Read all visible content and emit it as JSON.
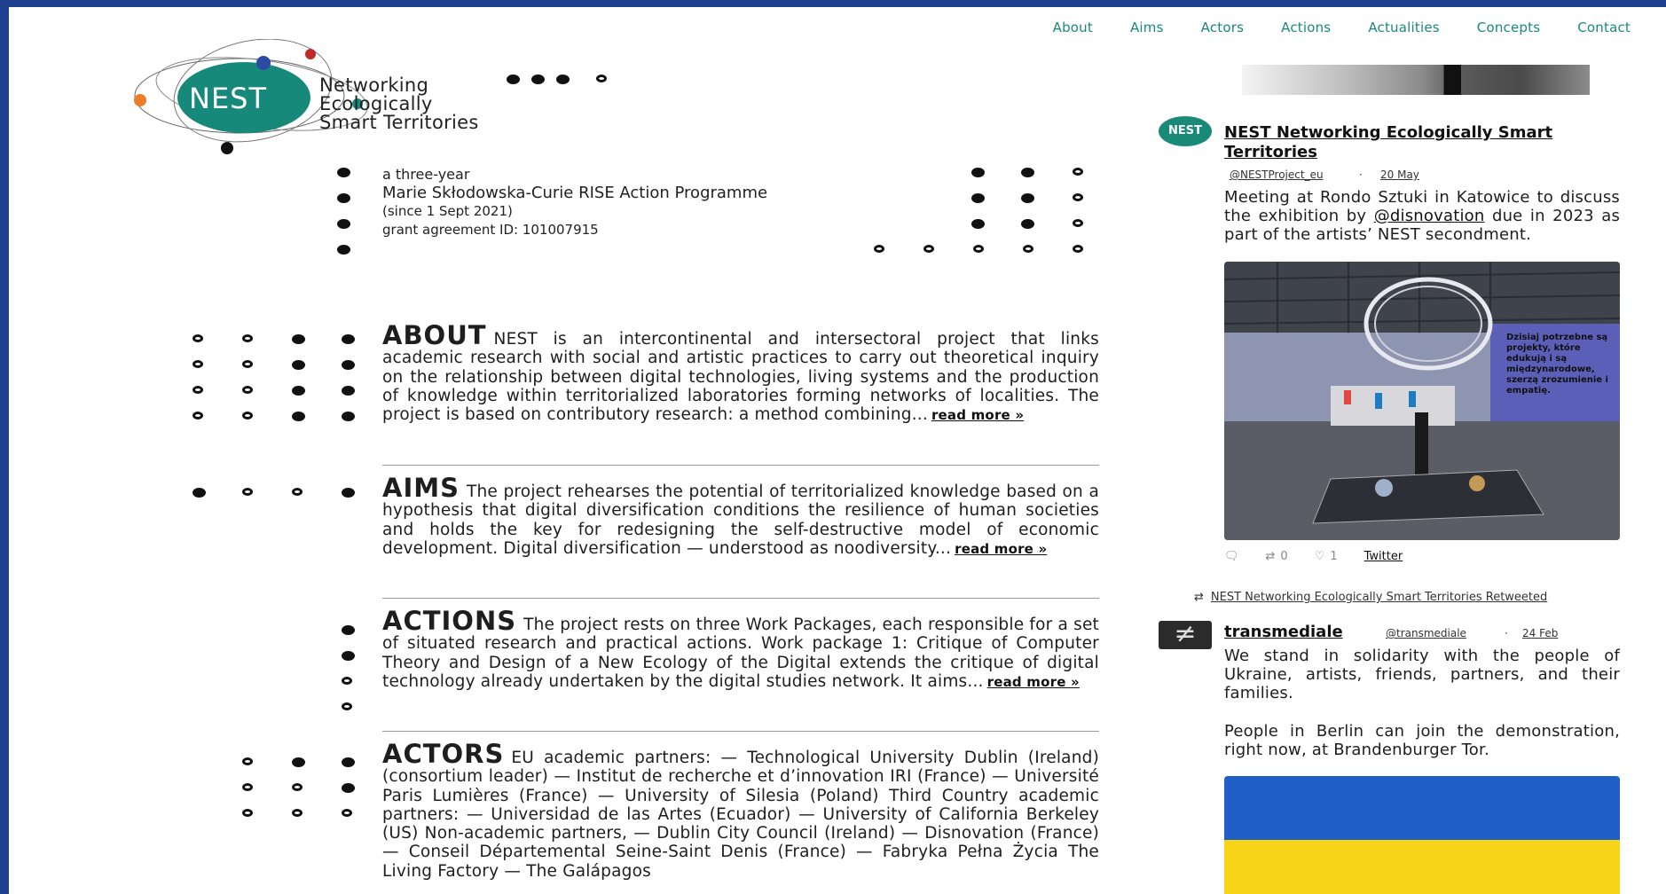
{
  "nav": [
    "About",
    "Aims",
    "Actors",
    "Actions",
    "Actualities",
    "Concepts",
    "Contact"
  ],
  "logo": {
    "mark": "NEST",
    "line1": "Networking",
    "line2": "Ecologically",
    "line3": "Smart Territories"
  },
  "intro": {
    "line1": "a three-year",
    "line2": "Marie Skłodowska-Curie RISE Action Programme",
    "line3": "(since 1 Sept 2021)",
    "line4": "grant agreement ID: 101007915"
  },
  "sections": {
    "about": {
      "head": "ABOUT",
      "text": "NEST is an intercontinental and intersectoral project that links academic research with social and artistic practices to carry out theoretical inquiry on the relationship between digital technologies, living systems and the production of knowledge within territorialized laboratories forming networks of localities. The project is based on contributory research: a method combining...",
      "more": "read more »"
    },
    "aims": {
      "head": "AIMS",
      "text": "The project rehearses the potential of territorialized knowledge based on a hypothesis that digital diversification conditions the resilience of human societies and holds the key for redesigning the self-destructive model of economic development. Digital diversification — understood as noodiversity...",
      "more": "read more »"
    },
    "actions": {
      "head": "ACTIONS",
      "text": "The project rests on three Work Packages, each responsible for a set of situated research and practical actions. Work package 1: Critique of Computer Theory and Design of a New Ecology of the Digital extends the critique of digital technology already undertaken by the digital studies network. It aims...",
      "more": "read more »"
    },
    "actors": {
      "head": "ACTORS",
      "text": "EU academic partners: — Technological University Dublin (Ireland) (consortium leader) — Institut de recherche et d’innovation IRI (France) — Université Paris Lumières (France) — University of Silesia (Poland) Third Country academic partners: — Universidad de las Artes (Ecuador) — University of California Berkeley (US) Non-academic partners, — Dublin City Council (Ireland) — Disnovation (France) — Conseil Départemental Seine-Saint Denis (France) — Fabryka Pełna Życia The Living Factory — The Galápagos"
    }
  },
  "twitter": {
    "tweet1": {
      "avatar": "NEST",
      "name": "NEST Networking Ecologically Smart Territories",
      "handle": "@NESTProject_eu",
      "date": "20 May",
      "text_pre": "Meeting at Rondo Sztuki in Katowice to discuss the exhibition by",
      "mention": "@disnovation",
      "text_post": "due in 2023 as part of the artists’ NEST secondment.",
      "photo_caption": "Dzisiaj potrzebne są projekty, które edukują i są międzynarodowe, szerzą zrozumienie i empatię.",
      "retweets": "0",
      "likes": "1",
      "source": "Twitter"
    },
    "retweet_label": "NEST Networking Ecologically Smart Territories Retweeted",
    "tweet2": {
      "avatar": "≠",
      "name": "transmediale",
      "handle": "@transmediale",
      "date": "24 Feb",
      "text1": "We stand in solidarity with the people of Ukraine, artists, friends, partners, and their families.",
      "text2": "People in Berlin can join the demonstration, right now, at Brandenburger Tor."
    }
  },
  "colors": {
    "accent": "#1a8a78",
    "frame": "#1f3f8f"
  }
}
